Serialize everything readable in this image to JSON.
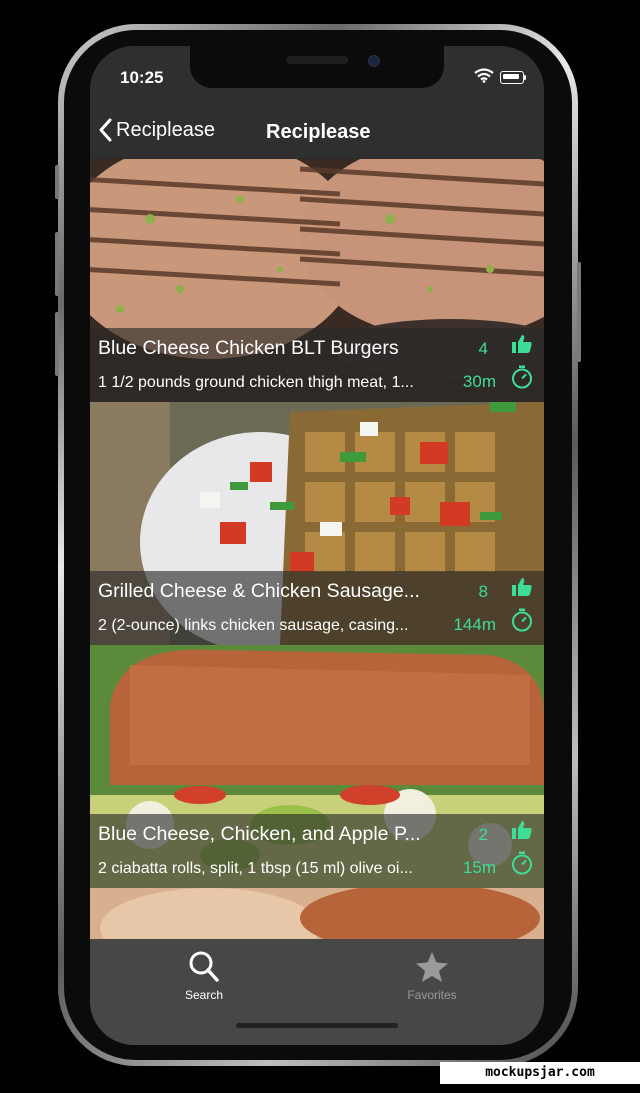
{
  "status_bar": {
    "time": "10:25"
  },
  "nav": {
    "back_label": "Reciplease",
    "title": "Reciplease"
  },
  "recipes": [
    {
      "title": "Blue Cheese Chicken BLT Burgers",
      "ingredients": "1 1/2 pounds ground chicken thigh meat, 1...",
      "likes": "4",
      "time": "30m"
    },
    {
      "title": "Grilled Cheese & Chicken Sausage...",
      "ingredients": "2 (2-ounce) links chicken sausage, casing...",
      "likes": "8",
      "time": "144m"
    },
    {
      "title": "Blue Cheese, Chicken, and Apple P...",
      "ingredients": "2 ciabatta rolls, split, 1 tbsp (15 ml) olive oi...",
      "likes": "2",
      "time": "15m"
    }
  ],
  "tabs": {
    "search_label": "Search",
    "favorites_label": "Favorites"
  },
  "watermark": "mockupsjar.com",
  "colors": {
    "accent": "#3ddc97",
    "bar": "#2f2f2f",
    "tab_bar": "#474747"
  },
  "icons": [
    "back-chevron-icon",
    "wifi-icon",
    "battery-icon",
    "thumbs-up-icon",
    "timer-icon",
    "search-icon",
    "star-icon"
  ]
}
